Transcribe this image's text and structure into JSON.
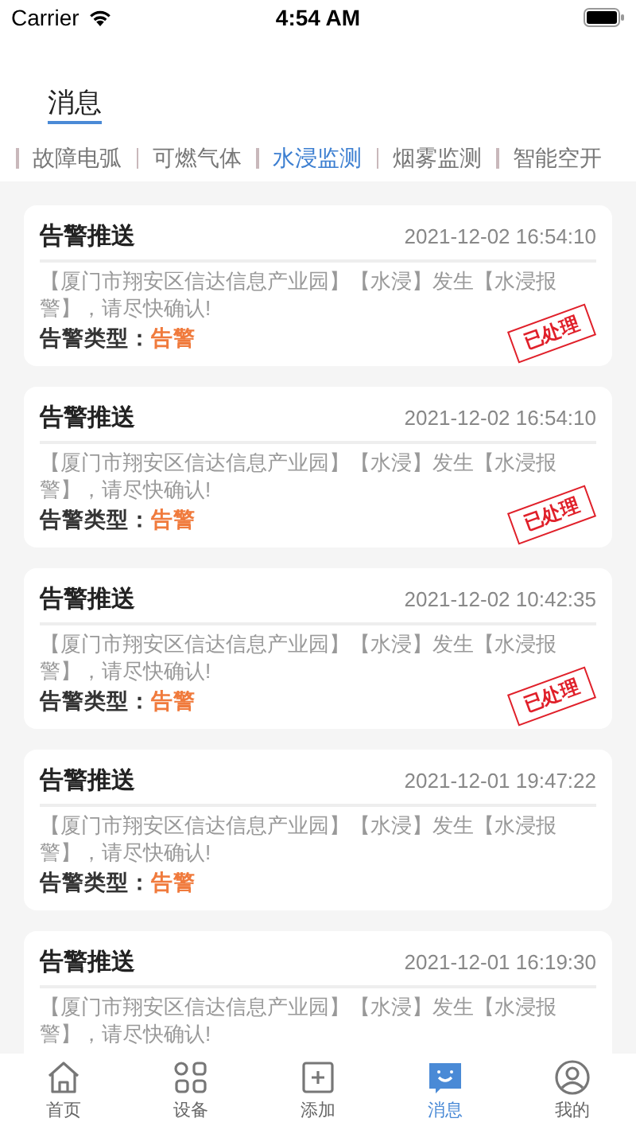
{
  "status_bar": {
    "carrier": "Carrier",
    "time": "4:54 AM"
  },
  "header": {
    "title": "消息"
  },
  "tabs": [
    {
      "label": "故障电弧",
      "selected": false
    },
    {
      "label": "可燃气体",
      "selected": false
    },
    {
      "label": "水浸监测",
      "selected": true
    },
    {
      "label": "烟雾监测",
      "selected": false
    },
    {
      "label": "智能空开",
      "selected": false
    }
  ],
  "messages": [
    {
      "title": "告警推送",
      "time": "2021-12-02 16:54:10",
      "text": "【厦门市翔安区信达信息产业园】【水浸】发生【水浸报警】，请尽快确认!",
      "type_label": "告警类型：",
      "type_value": "告警",
      "stamp": "已处理"
    },
    {
      "title": "告警推送",
      "time": "2021-12-02 16:54:10",
      "text": "【厦门市翔安区信达信息产业园】【水浸】发生【水浸报警】，请尽快确认!",
      "type_label": "告警类型：",
      "type_value": "告警",
      "stamp": "已处理"
    },
    {
      "title": "告警推送",
      "time": "2021-12-02 10:42:35",
      "text": "【厦门市翔安区信达信息产业园】【水浸】发生【水浸报警】，请尽快确认!",
      "type_label": "告警类型：",
      "type_value": "告警",
      "stamp": "已处理"
    },
    {
      "title": "告警推送",
      "time": "2021-12-01 19:47:22",
      "text": "【厦门市翔安区信达信息产业园】【水浸】发生【水浸报警】，请尽快确认!",
      "type_label": "告警类型：",
      "type_value": "告警"
    },
    {
      "title": "告警推送",
      "time": "2021-12-01 16:19:30",
      "text": "【厦门市翔安区信达信息产业园】【水浸】发生【水浸报警】，请尽快确认!"
    }
  ],
  "tab_bar": [
    {
      "kind": "home",
      "label": "首页",
      "selected": false
    },
    {
      "kind": "devices",
      "label": "设备",
      "selected": false
    },
    {
      "kind": "add",
      "label": "添加",
      "selected": false
    },
    {
      "kind": "messages",
      "label": "消息",
      "selected": true
    },
    {
      "kind": "profile",
      "label": "我的",
      "selected": false
    }
  ]
}
